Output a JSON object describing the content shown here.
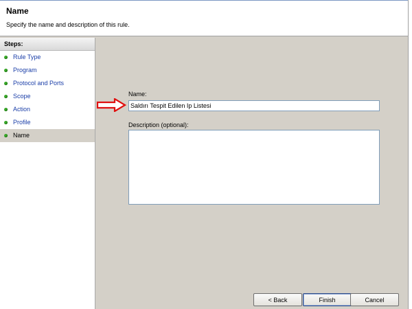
{
  "header": {
    "title": "Name",
    "subtitle": "Specify the name and description of this rule."
  },
  "steps": {
    "heading": "Steps:",
    "items": [
      {
        "label": "Rule Type"
      },
      {
        "label": "Program"
      },
      {
        "label": "Protocol and Ports"
      },
      {
        "label": "Scope"
      },
      {
        "label": "Action"
      },
      {
        "label": "Profile"
      },
      {
        "label": "Name"
      }
    ],
    "active_index": 6
  },
  "form": {
    "name_label": "Name:",
    "name_value": "Saldırı Tespit Edilen Ip Listesi",
    "description_label": "Description (optional):",
    "description_value": ""
  },
  "buttons": {
    "back": "< Back",
    "finish": "Finish",
    "cancel": "Cancel"
  },
  "colors": {
    "step_link": "#1a3ea8",
    "step_bullet": "#3aa82a",
    "annotation_arrow": "#e01010"
  }
}
